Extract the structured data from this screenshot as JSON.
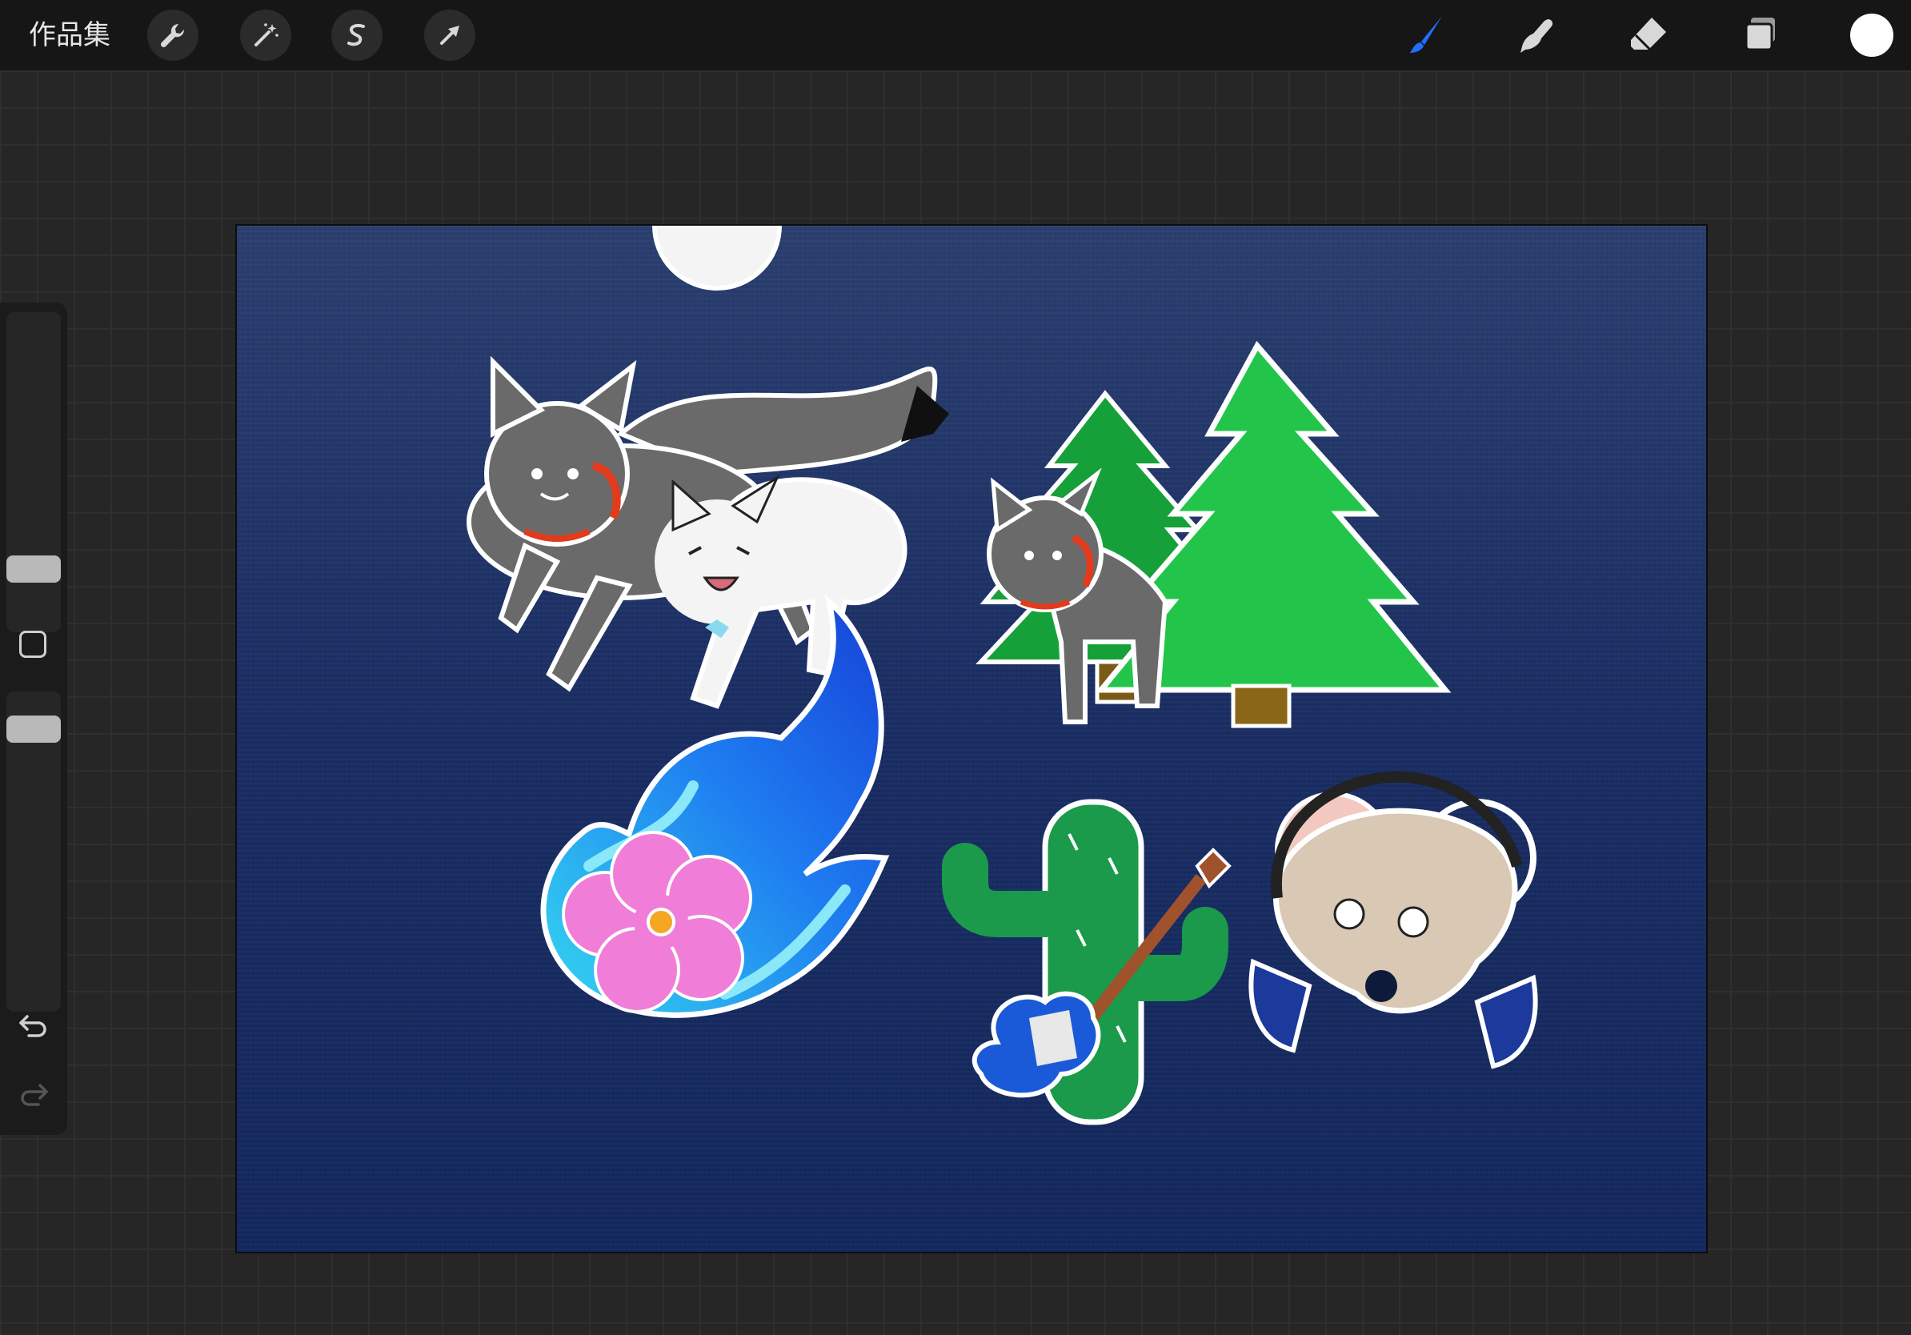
{
  "app": {
    "gallery_label": "作品集"
  },
  "toolbar": {
    "left_tools": [
      {
        "name": "actions",
        "icon": "wrench-icon"
      },
      {
        "name": "adjustments",
        "icon": "magic-wand-icon"
      },
      {
        "name": "selection",
        "icon": "selection-s-icon"
      },
      {
        "name": "transform",
        "icon": "arrow-cursor-icon"
      }
    ],
    "right_tools": [
      {
        "name": "brush",
        "icon": "brush-icon",
        "active": true,
        "color": "#1f6fff"
      },
      {
        "name": "smudge",
        "icon": "smudge-finger-icon"
      },
      {
        "name": "eraser",
        "icon": "eraser-icon"
      },
      {
        "name": "layers",
        "icon": "layers-icon"
      }
    ],
    "current_color": "#ffffff"
  },
  "sidebar": {
    "brush_size_icon": "size-slider",
    "opacity_icon": "opacity-slider",
    "modify_icon": "square-modify-icon",
    "undo_icon": "undo-icon",
    "redo_icon": "redo-icon"
  },
  "canvas": {
    "background_top": "#2a3f70",
    "background_bottom": "#12275c",
    "artwork": [
      {
        "name": "two-cats-running-sticker"
      },
      {
        "name": "cat-with-pine-trees-sticker"
      },
      {
        "name": "blue-flame-sakura-sticker"
      },
      {
        "name": "cactus-guitar-sticker"
      },
      {
        "name": "mouse-headphones-sticker"
      }
    ]
  }
}
